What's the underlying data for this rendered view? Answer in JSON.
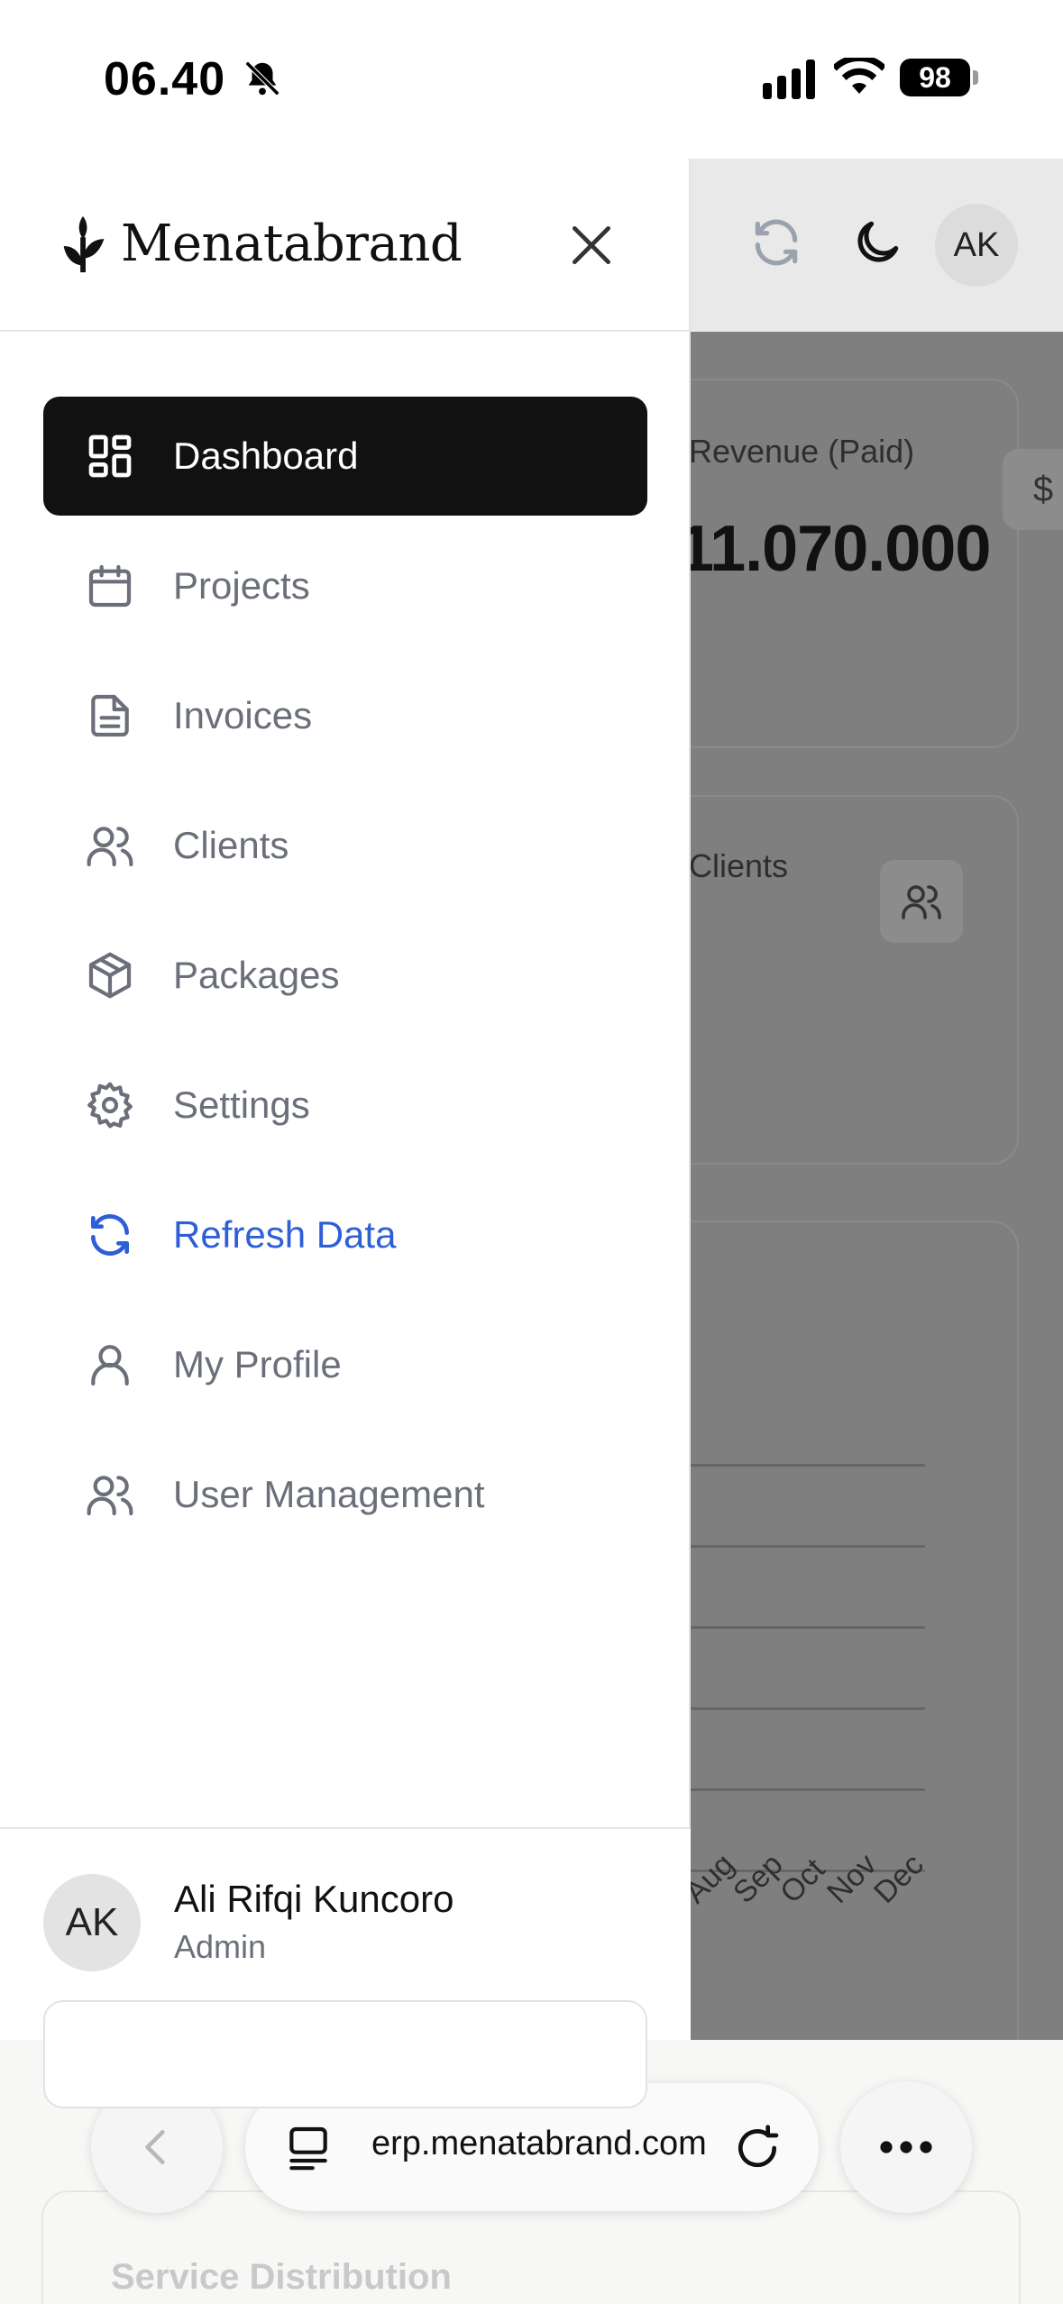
{
  "status_bar": {
    "time": "06.40",
    "battery": "98"
  },
  "drawer": {
    "brand": "Menatabrand",
    "nav_items": [
      {
        "label": "Dashboard",
        "icon": "dashboard-icon",
        "active": true
      },
      {
        "label": "Projects",
        "icon": "calendar-icon"
      },
      {
        "label": "Invoices",
        "icon": "document-icon"
      },
      {
        "label": "Clients",
        "icon": "users-icon"
      },
      {
        "label": "Packages",
        "icon": "package-icon"
      },
      {
        "label": "Settings",
        "icon": "gear-icon"
      },
      {
        "label": "Refresh Data",
        "icon": "refresh-icon",
        "accent": "#2f5fd7"
      },
      {
        "label": "My Profile",
        "icon": "user-icon"
      },
      {
        "label": "User Management",
        "icon": "users-icon"
      }
    ],
    "user": {
      "initials": "AK",
      "name": "Ali Rifqi Kuncoro",
      "role": "Admin"
    }
  },
  "background_app": {
    "avatar_initials": "AK",
    "revenue_label": "Revenue (Paid)",
    "revenue_value": "11.070.000",
    "dollar_icon": "$",
    "clients_label": "Clients",
    "months": [
      "Aug",
      "Sep",
      "Oct",
      "Nov",
      "Dec"
    ],
    "service_distribution": "Service Distribution"
  },
  "browser": {
    "url": "erp.menatabrand.com"
  },
  "colors": {
    "active_bg": "#111111",
    "accent_blue": "#2f5fd7",
    "muted_text": "#6b6f7a"
  }
}
